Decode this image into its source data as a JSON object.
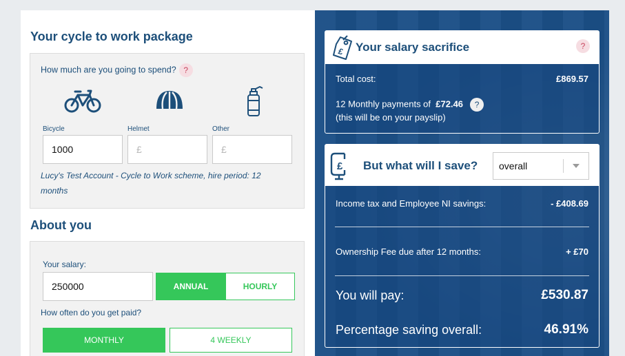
{
  "package": {
    "title": "Your cycle to work package",
    "spend_question": "How much are you going to spend?",
    "help_glyph": "?",
    "items": [
      {
        "label": "Bicycle",
        "value": "1000",
        "placeholder": "",
        "icon": "bicycle-icon"
      },
      {
        "label": "Helmet",
        "value": "",
        "placeholder": "£",
        "icon": "helmet-icon"
      },
      {
        "label": "Other",
        "value": "",
        "placeholder": "£",
        "icon": "water-bottle-icon"
      }
    ],
    "note": "Lucy's Test Account - Cycle to Work scheme, hire period: 12 months"
  },
  "about": {
    "title": "About you",
    "salary_label": "Your salary:",
    "salary_value": "250000",
    "period_buttons": [
      "ANNUAL",
      "HOURLY"
    ],
    "period_selected": "ANNUAL",
    "paid_question": "How often do you get paid?",
    "frequency_buttons": [
      "MONTHLY",
      "4 WEEKLY"
    ],
    "frequency_selected": "MONTHLY"
  },
  "sacrifice": {
    "title": "Your salary sacrifice",
    "help_glyph": "?",
    "icon": "price-tag-pound-icon",
    "total_label": "Total cost:",
    "total_value": "£869.57",
    "monthly_prefix": "12 Monthly payments of",
    "monthly_value": "£72.46",
    "monthly_note": "(this will be on your payslip)"
  },
  "savings": {
    "title": "But what will I save?",
    "icon": "clamp-pound-icon",
    "select_value": "overall",
    "rows": [
      {
        "label": "Income tax and Employee NI savings:",
        "value": "- £408.69"
      },
      {
        "label": "Ownership Fee due after 12 months:",
        "value": "+ £70"
      }
    ],
    "pay_label": "You will pay:",
    "pay_value": "£530.87",
    "pct_label": "Percentage saving overall:",
    "pct_value": "46.91%"
  },
  "colors": {
    "brand_blue": "#1d4f7a",
    "panel_blue": "#1b4f86",
    "accent_green": "#35c75a",
    "help_pink": "#f6dde2"
  }
}
